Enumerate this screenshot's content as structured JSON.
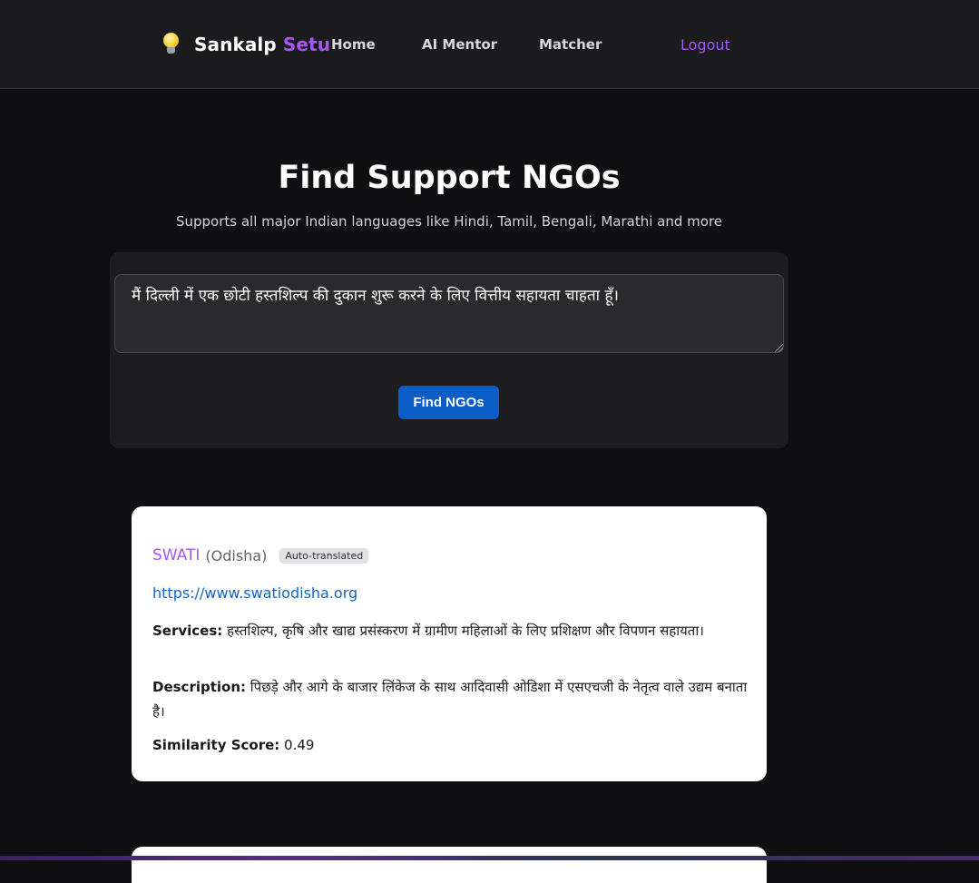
{
  "nav": {
    "brand_main": "Sankalp",
    "brand_accent": "Setu",
    "links": [
      "Home",
      "AI Mentor",
      "Matcher"
    ],
    "logout": "Logout"
  },
  "hero": {
    "title": "Find Support NGOs",
    "subtitle": "Supports all major Indian languages like Hindi, Tamil, Bengali, Marathi and more"
  },
  "search": {
    "query": "मैं दिल्ली में एक छोटी हस्तशिल्प की दुकान शुरू करने के लिए वित्तीय सहायता चाहता हूँ।",
    "button_label": "Find NGOs"
  },
  "results": [
    {
      "name": "SWATI",
      "region": "(Odisha)",
      "badge": "Auto-translated",
      "url": "https://www.swatiodisha.org",
      "services_label": "Services:",
      "services": "हस्तशिल्प, कृषि और खाद्य प्रसंस्करण में ग्रामीण महिलाओं के लिए प्रशिक्षण और विपणन सहायता।",
      "description_label": "Description:",
      "description": "पिछड़े और आगे के बाजार लिंकेज के साथ आदिवासी ओडिशा में एसएचजी के नेतृत्व वाले उद्यम बनाता है।",
      "similarity_label": "Similarity Score:",
      "similarity": "0.49"
    }
  ],
  "colors": {
    "background": "#0f0f11",
    "navbar": "#1b1b1d",
    "accent": "#a855f7",
    "button": "#0b5ec7",
    "link": "#1565c0"
  },
  "icons": {
    "brand": "lightbulb-icon"
  }
}
